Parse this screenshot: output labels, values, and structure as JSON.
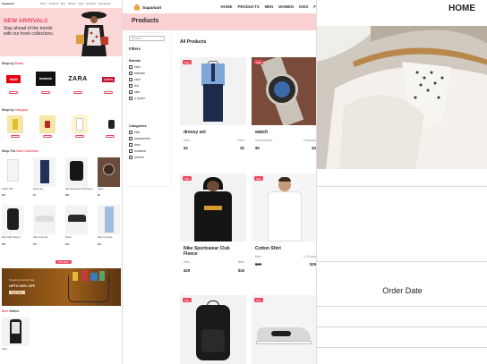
{
  "panel_home": {
    "nav": {
      "brand": "Supamart",
      "links": [
        "Home",
        "Products",
        "Men",
        "Women",
        "Kids",
        "Footwear",
        "Accessories"
      ]
    },
    "hero": {
      "headline": "NEW ARRIVALS",
      "subline": "Stay ahead of the trends with our fresh collections."
    },
    "shop_by_brand": {
      "prefix": "Shop by",
      "accent": "Brand"
    },
    "brands": [
      "H&M",
      "fasttrack",
      "ZARA",
      "Levi's"
    ],
    "shop_by_category": {
      "prefix": "Shop by",
      "accent": "Category"
    },
    "shop_new": {
      "prefix": "Shop The",
      "accent": "New Collection"
    },
    "new_products": [
      {
        "name": "Cotton Shirt",
        "price": "$25"
      },
      {
        "name": "dressy set",
        "price": "$4"
      },
      {
        "name": "Nike Sportswear Club Fleece",
        "price": "$26"
      },
      {
        "name": "watch",
        "price": "$6"
      },
      {
        "name": "Nike Utility Speed 2",
        "price": "$30"
      },
      {
        "name": "Nike Dunk Low",
        "price": "$17"
      },
      {
        "name": "Shoes",
        "price": "$19"
      },
      {
        "name": "Wide-leg Jeans",
        "price": "$24"
      }
    ],
    "view_more": "View More",
    "promo_line": "Shopping Festival Sale",
    "promo_discount": "UPTO 50% OFF",
    "promo_button": "Shop Now",
    "best_sellers": {
      "prefix": "Best",
      "accent": "Sellers"
    },
    "best_seller_item": "dress"
  },
  "panel_products": {
    "brand": "Supamart",
    "menu": [
      "HOME",
      "PRODUCTS",
      "MEN",
      "WOMEN",
      "KIDS",
      "F"
    ],
    "banner_title": "Products",
    "search_placeholder": "Search...",
    "filters_label": "Filters",
    "brands_label": "Brands",
    "brand_options": [
      "h&m",
      "fastrack",
      "zara",
      "levi",
      "nike",
      "u.s.polo"
    ],
    "categories_label": "Categories",
    "category_options": [
      "kids",
      "accessories",
      "men",
      "footwear",
      "women"
    ],
    "all_products_label": "All Products",
    "sale_badge": "Sale",
    "products": [
      {
        "name": "dressy set",
        "category": "Kids",
        "brand": "Filter",
        "old_price": "",
        "price": "$4",
        "current": "$2"
      },
      {
        "name": "watch",
        "category": "Accessories",
        "brand": "Fastrack",
        "old_price": "",
        "price": "$6",
        "current": "$4"
      },
      {
        "name": "Nike Sportswear Club Fleece",
        "category": "Kids",
        "brand": "Nike",
        "old_price": "",
        "price": "$29",
        "current": "$26"
      },
      {
        "name": "Cotton Shirt",
        "category": "Men",
        "brand": "U.S.polo",
        "old_price": "$29",
        "price": "",
        "current": "$25"
      }
    ]
  },
  "panel_orders": {
    "title": "HOME",
    "order_date_label": "Order Date"
  },
  "colors": {
    "accent": "#e84a5f",
    "banner_pink": "#fbd0d3"
  }
}
